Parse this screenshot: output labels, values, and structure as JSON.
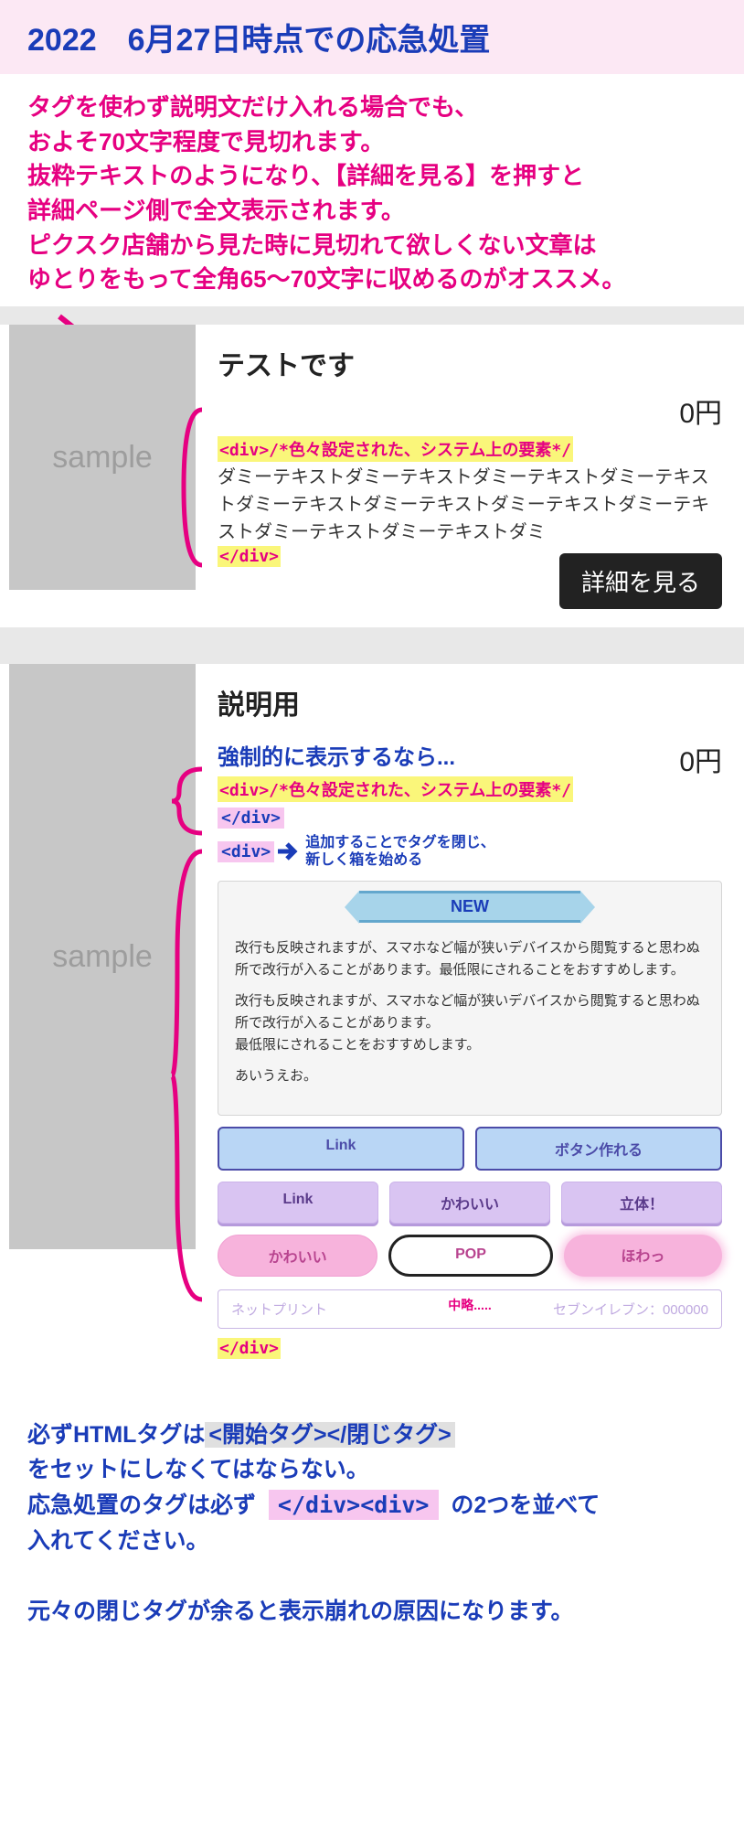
{
  "header": {
    "title": "2022　6月27日時点での応急処置"
  },
  "intro": {
    "l1": "タグを使わず説明文だけ入れる場合でも、",
    "l2": "およそ70文字程度で見切れます。",
    "l3": "抜粋テキストのようになり、【詳細を見る】を押すと",
    "l4": "詳細ページ側で全文表示されます。",
    "l5": "ピクスク店舗から見た時に見切れて欲しくない文章は",
    "l6": "ゆとりをもって全角65〜70文字に収めるのがオススメ。"
  },
  "sample_label": "sample",
  "card1": {
    "title": "テストです",
    "price": "0円",
    "open_tag": "<div>/*色々設定された、システム上の要素*/",
    "dummy": "ダミーテキストダミーテキストダミーテキストダミーテキストダミーテキストダミーテキストダミーテキストダミーテキストダミーテキストダミーテキストダミ",
    "close_tag": "</div>",
    "button": "詳細を見る"
  },
  "card2": {
    "title": "説明用",
    "subheading": "強制的に表示するなら...",
    "price": "0円",
    "open_tag": "<div>/*色々設定された、システム上の要素*/",
    "close_tag_pink": "</div>",
    "open_tag_pink": "<div>",
    "arrow_note_l1": "追加することでタグを閉じ、",
    "arrow_note_l2": "新しく箱を始める",
    "ribbon": "NEW",
    "para1": "改行も反映されますが、スマホなど幅が狭いデバイスから閲覧すると思わぬ所で改行が入ることがあります。最低限にされることをおすすめします。",
    "para2": "改行も反映されますが、スマホなど幅が狭いデバイスから閲覧すると思わぬ所で改行が入ることがあります。",
    "para3": "最低限にされることをおすすめします。",
    "para4": "あいうえお。",
    "buttons": {
      "b1": "Link",
      "b2": "ボタン作れる",
      "b3": "Link",
      "b4": "かわいい",
      "b5": "立体！",
      "b6": "かわいい",
      "b7": "POP",
      "b8": "ほわっ"
    },
    "faded_left": "ネットプリント",
    "faded_right": "セブンイレブン：000000",
    "omit": "中略.....",
    "final_close": "</div>"
  },
  "footer": {
    "l1_a": "必ずHTMLタグは",
    "l1_b": "<開始タグ></閉じタグ>",
    "l2": "をセットにしなくてはならない。",
    "l3_a": "応急処置のタグは必ず",
    "l3_tag": "</div><div>",
    "l3_b": "の2つを並べて",
    "l4": "入れてください。",
    "l5": "元々の閉じタグが余ると表示崩れの原因になります。"
  }
}
